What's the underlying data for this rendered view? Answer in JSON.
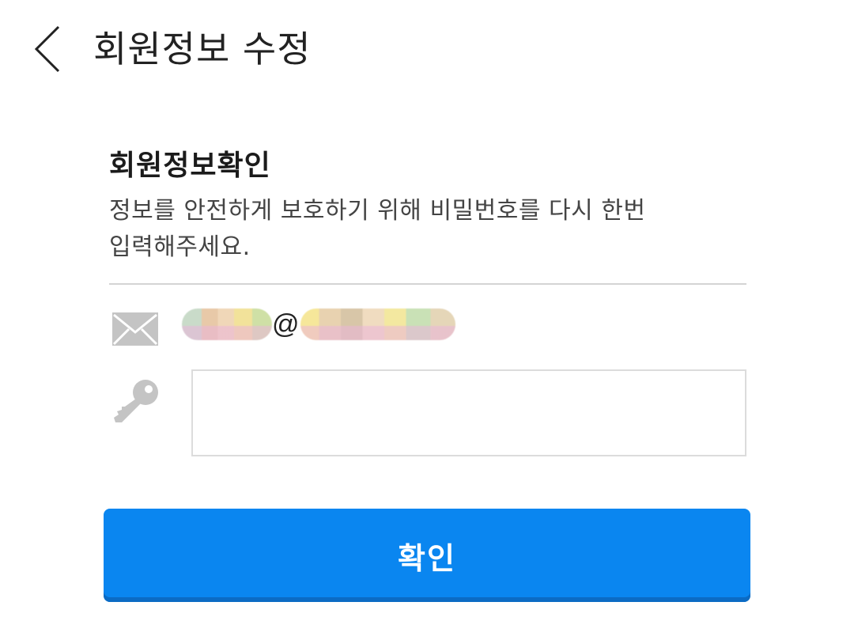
{
  "header": {
    "title": "회원정보 수정",
    "back_icon": "chevron-left-icon"
  },
  "section": {
    "title": "회원정보확인",
    "description_line1": "정보를 안전하게 보호하기 위해 비밀번호를 다시 한번",
    "description_line2": "입력해주세요."
  },
  "account": {
    "email_icon": "envelope-icon",
    "email_separator": "@",
    "email_redacted": true
  },
  "password": {
    "icon": "key-icon",
    "value": "",
    "placeholder": ""
  },
  "confirm_button": {
    "label": "확인",
    "color": "#0a86f0"
  },
  "colors": {
    "icon_gray": "#c4c4c4",
    "divider": "#d4d4d4",
    "input_border": "#dcdcdc"
  }
}
